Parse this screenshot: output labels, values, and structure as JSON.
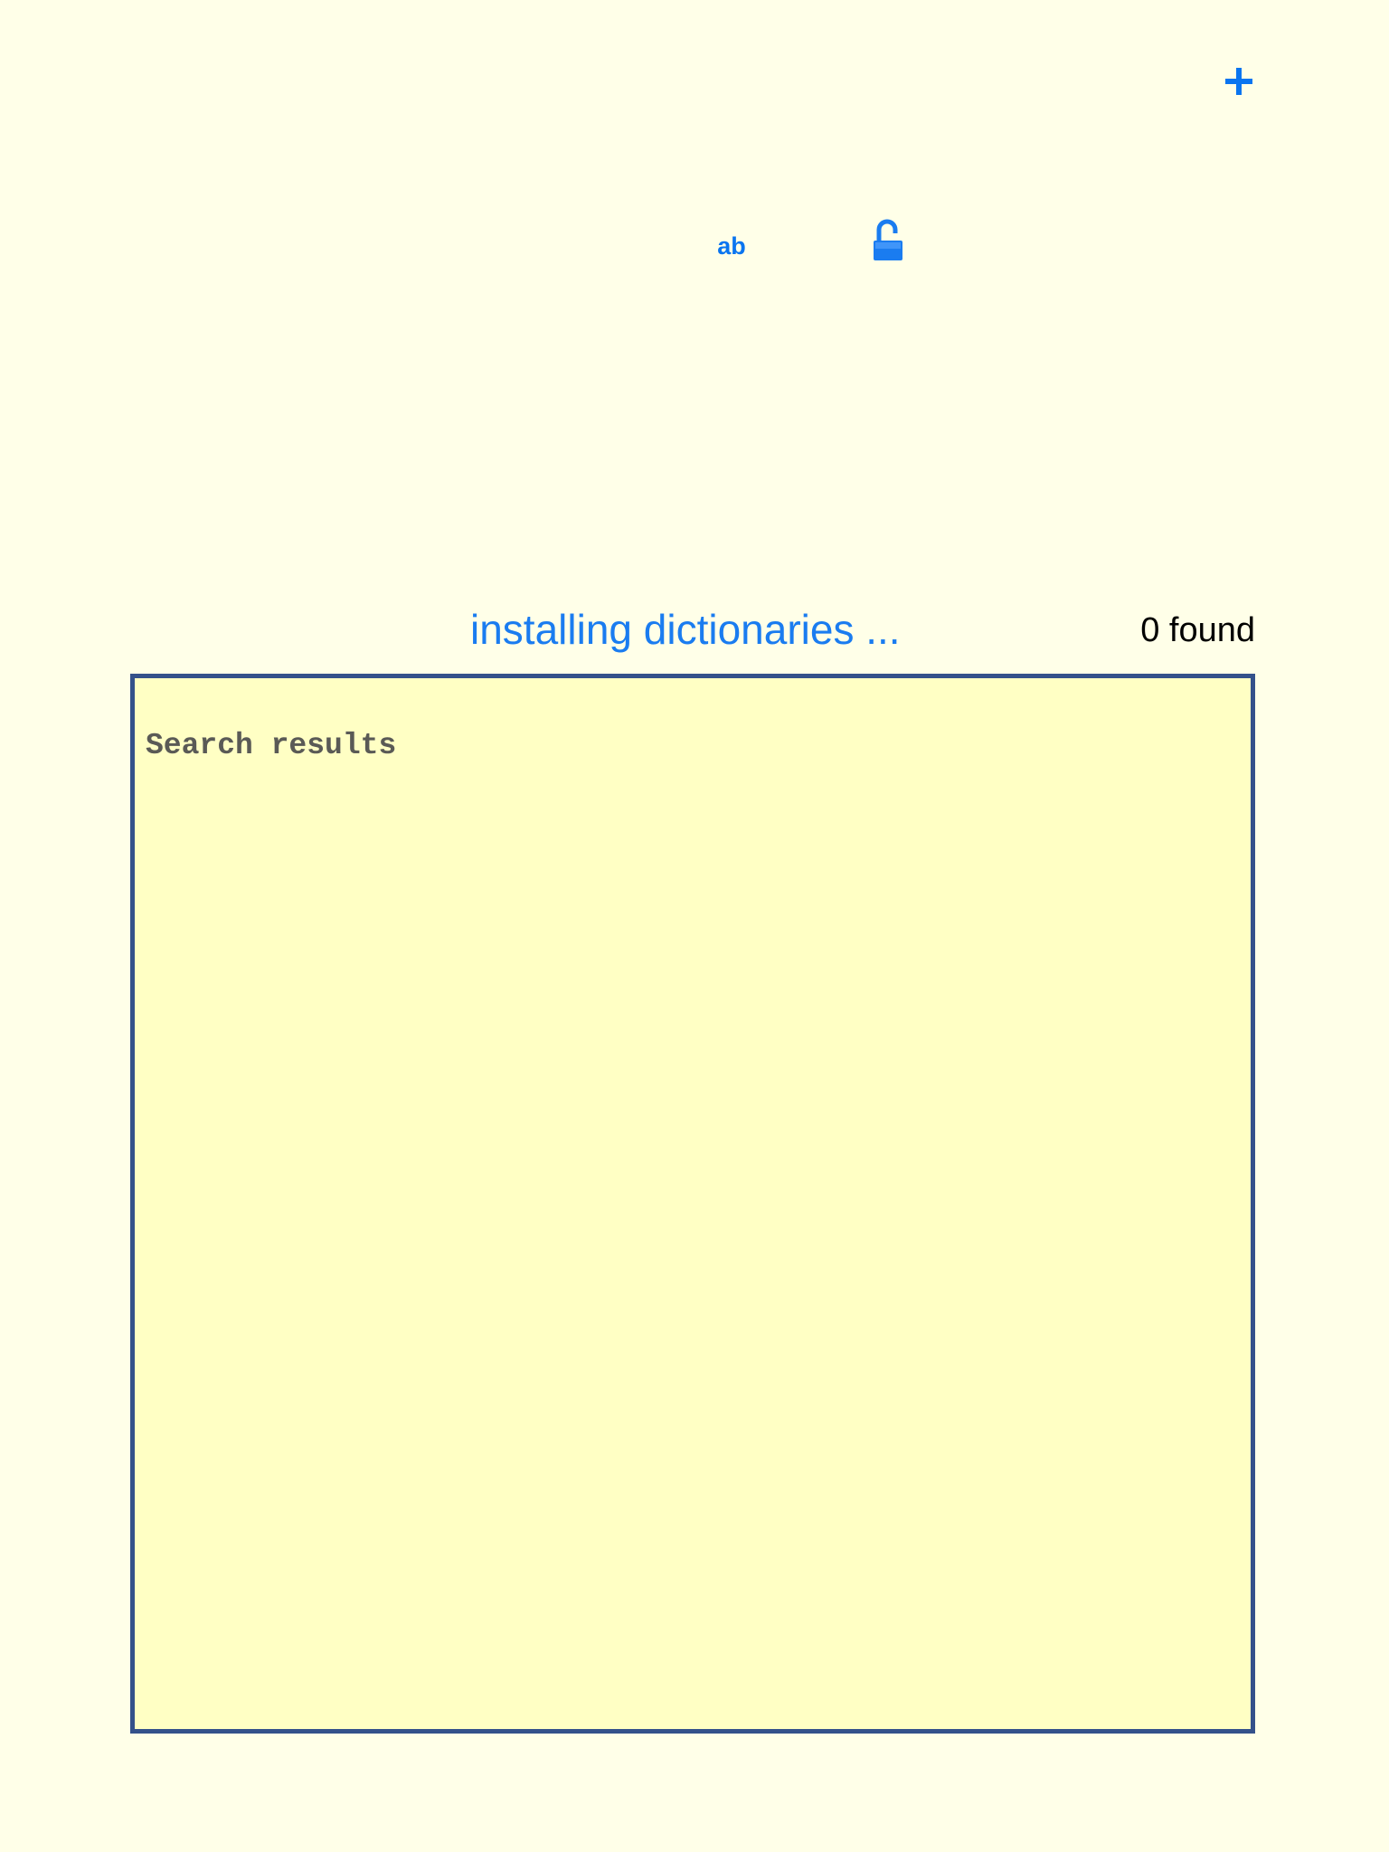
{
  "toolbar": {
    "add_icon": "plus-icon",
    "ab_label": "ab",
    "lock_icon": "unlocked-padlock-icon"
  },
  "status": {
    "message": "installing dictionaries ...",
    "found": "0 found"
  },
  "results": {
    "label": "Search results"
  },
  "colors": {
    "background": "#ffffe8",
    "accent": "#0a75f0",
    "panel_background": "#ffffc4",
    "panel_border": "#34518a"
  }
}
